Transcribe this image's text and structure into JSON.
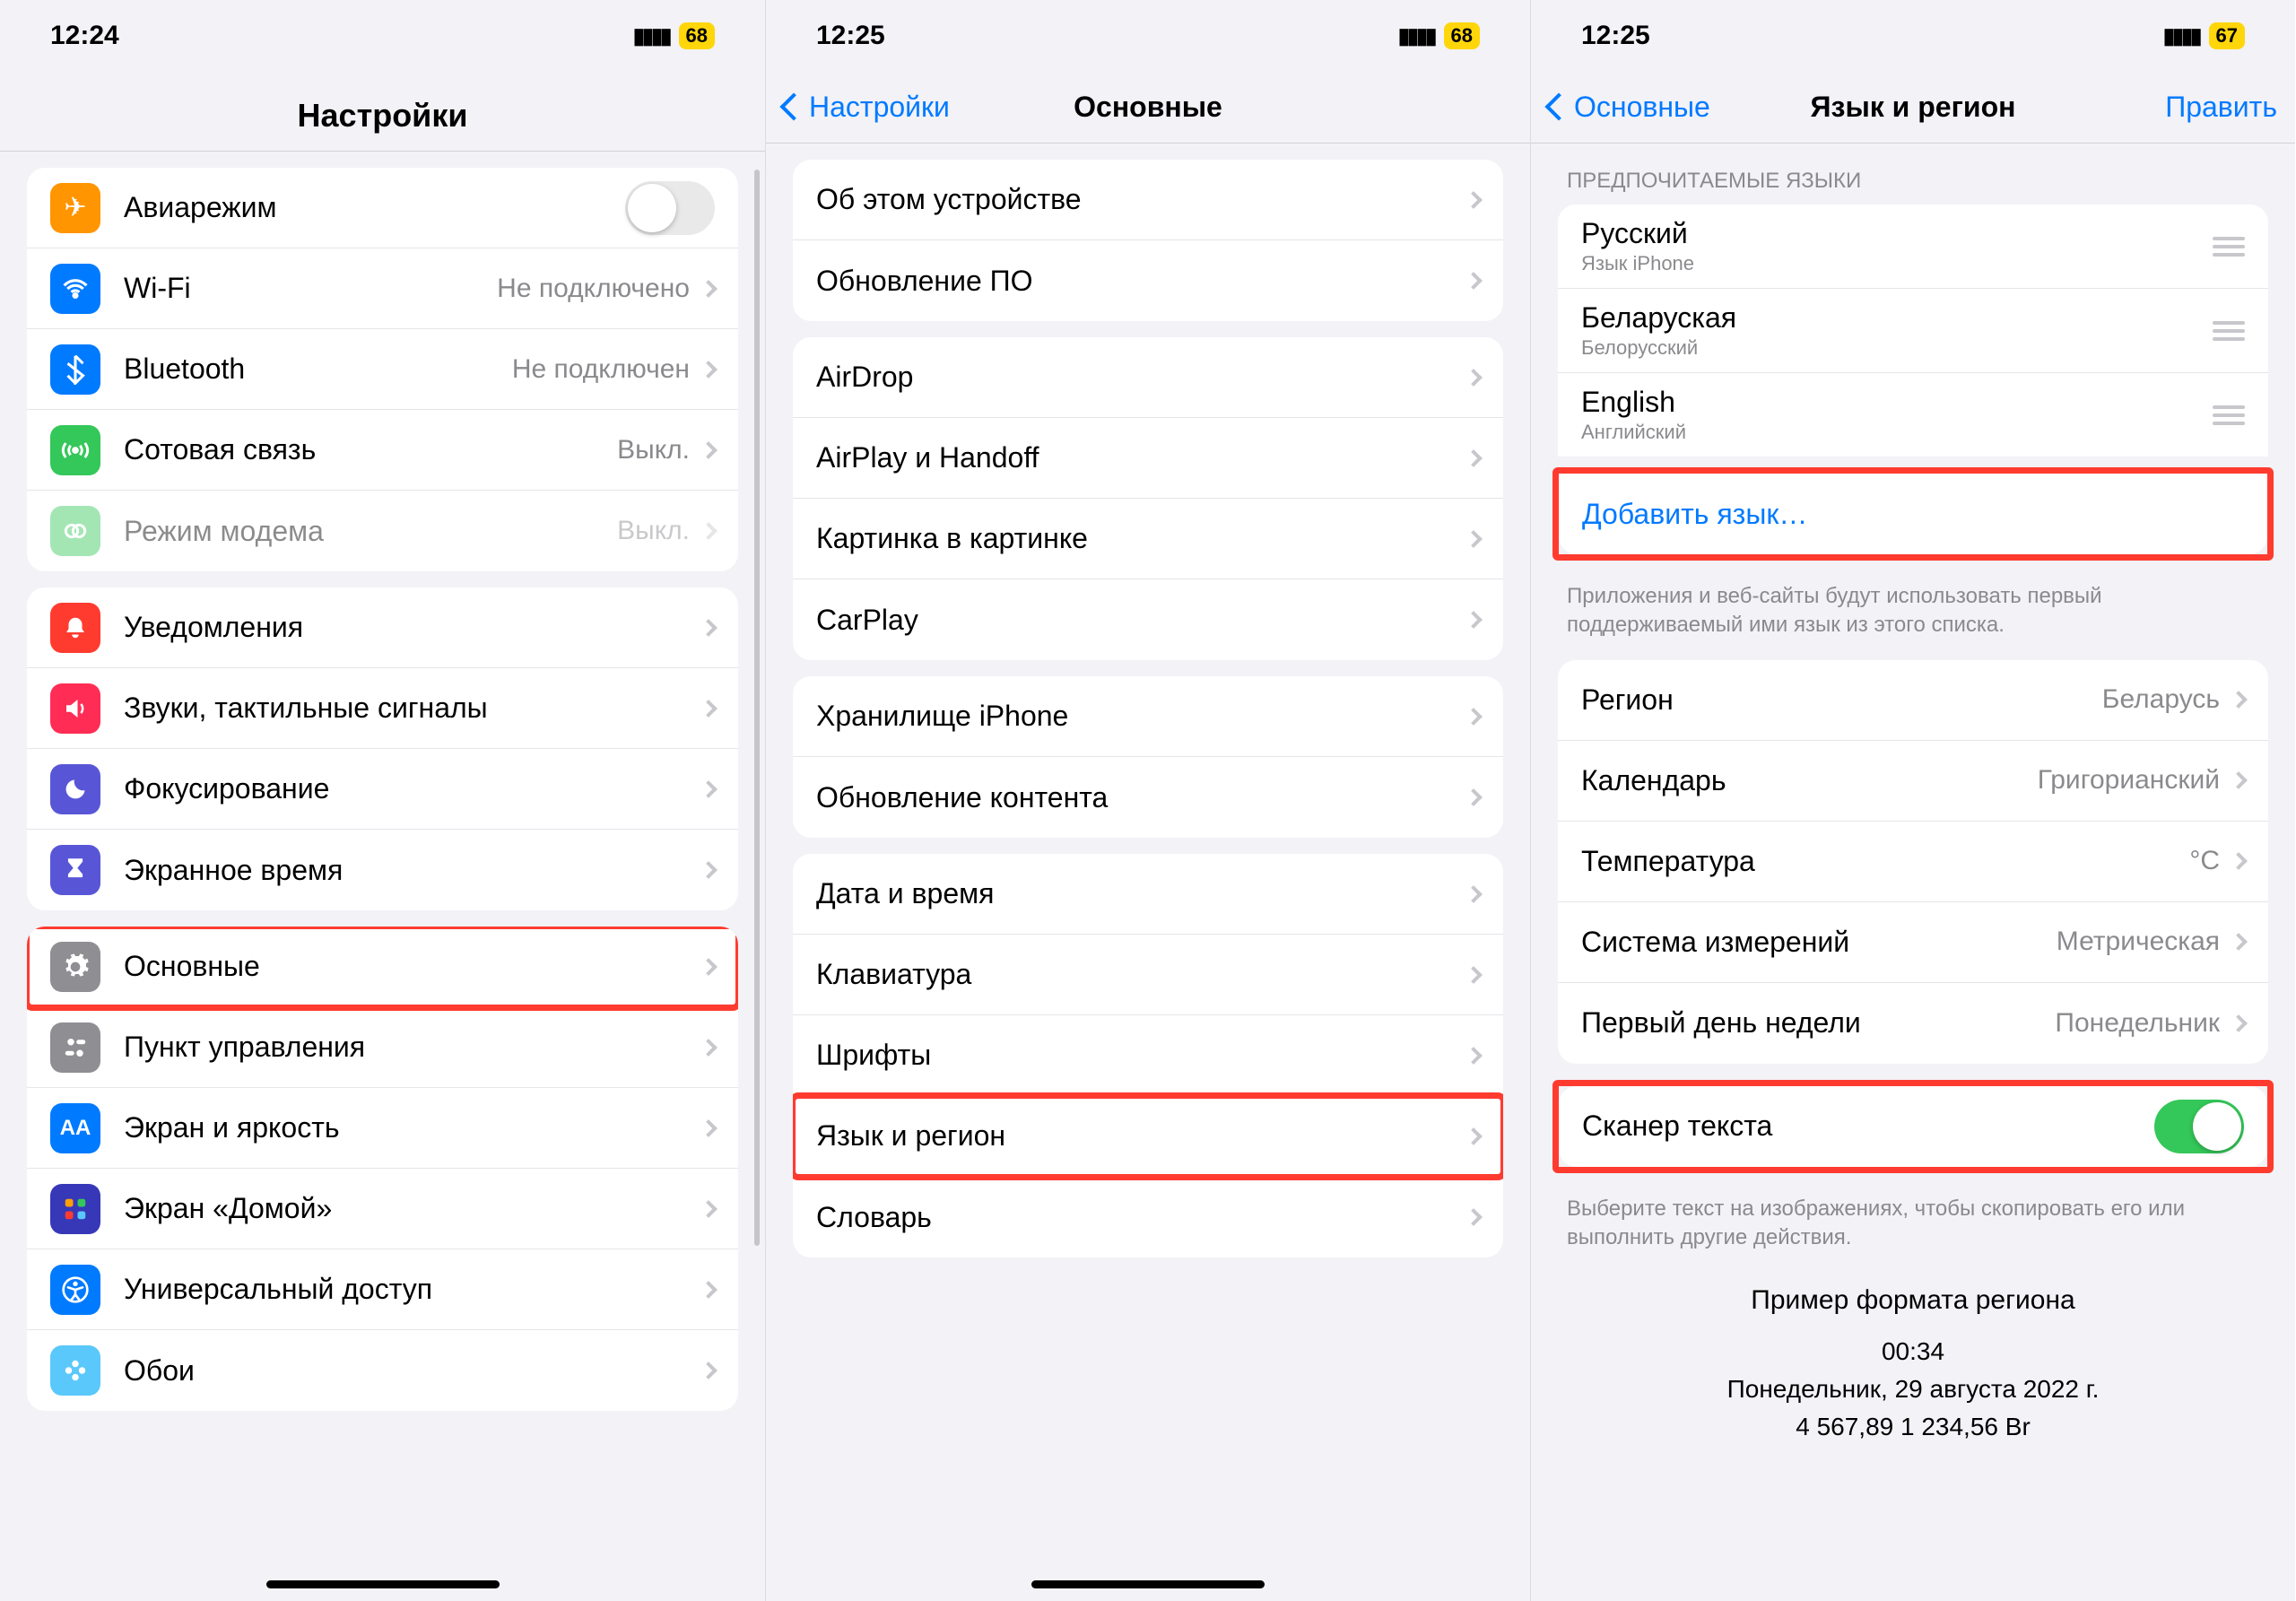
{
  "phones": {
    "p1": {
      "time": "12:24",
      "battery": "68"
    },
    "p2": {
      "time": "12:25",
      "battery": "68"
    },
    "p3": {
      "time": "12:25",
      "battery": "67"
    }
  },
  "p1": {
    "title": "Настройки",
    "g1": {
      "airplane": "Авиарежим",
      "wifi": "Wi-Fi",
      "wifi_detail": "Не подключено",
      "bt": "Bluetooth",
      "bt_detail": "Не подключен",
      "cell": "Сотовая связь",
      "cell_detail": "Выкл.",
      "hotspot": "Режим модема",
      "hotspot_detail": "Выкл."
    },
    "g2": {
      "notif": "Уведомления",
      "sounds": "Звуки, тактильные сигналы",
      "focus": "Фокусирование",
      "screentime": "Экранное время"
    },
    "g3": {
      "general": "Основные",
      "control": "Пункт управления",
      "display": "Экран и яркость",
      "home": "Экран «Домой»",
      "access": "Универсальный доступ",
      "wallpaper": "Обои"
    }
  },
  "p2": {
    "back": "Настройки",
    "title": "Основные",
    "g1": {
      "about": "Об этом устройстве",
      "update": "Обновление ПО"
    },
    "g2": {
      "airdrop": "AirDrop",
      "airplay": "AirPlay и Handoff",
      "pip": "Картинка в картинке",
      "carplay": "CarPlay"
    },
    "g3": {
      "storage": "Хранилище iPhone",
      "bgrefresh": "Обновление контента"
    },
    "g4": {
      "datetime": "Дата и время",
      "keyboard": "Клавиатура",
      "fonts": "Шрифты",
      "lang": "Язык и регион",
      "dict": "Словарь"
    }
  },
  "p3": {
    "back": "Основные",
    "title": "Язык и регион",
    "edit": "Править",
    "header_langs": "ПРЕДПОЧИТАЕМЫЕ ЯЗЫКИ",
    "langs": [
      {
        "name": "Русский",
        "sub": "Язык iPhone"
      },
      {
        "name": "Беларуская",
        "sub": "Белорусский"
      },
      {
        "name": "English",
        "sub": "Английский"
      }
    ],
    "add_lang": "Добавить язык…",
    "footer_langs": "Приложения и веб-сайты будут использовать первый поддерживаемый ими язык из этого списка.",
    "region": {
      "label": "Регион",
      "value": "Беларусь"
    },
    "calendar": {
      "label": "Календарь",
      "value": "Григорианский"
    },
    "temp": {
      "label": "Температура",
      "value": "°C"
    },
    "measure": {
      "label": "Система измерений",
      "value": "Метрическая"
    },
    "weekstart": {
      "label": "Первый день недели",
      "value": "Понедельник"
    },
    "livetext": "Сканер текста",
    "footer_livetext": "Выберите текст на изображениях, чтобы скопировать его или выполнить другие действия.",
    "example_title": "Пример формата региона",
    "example_time": "00:34",
    "example_date": "Понедельник, 29 августа 2022 г.",
    "example_num": "4 567,89 1 234,56 Br"
  }
}
